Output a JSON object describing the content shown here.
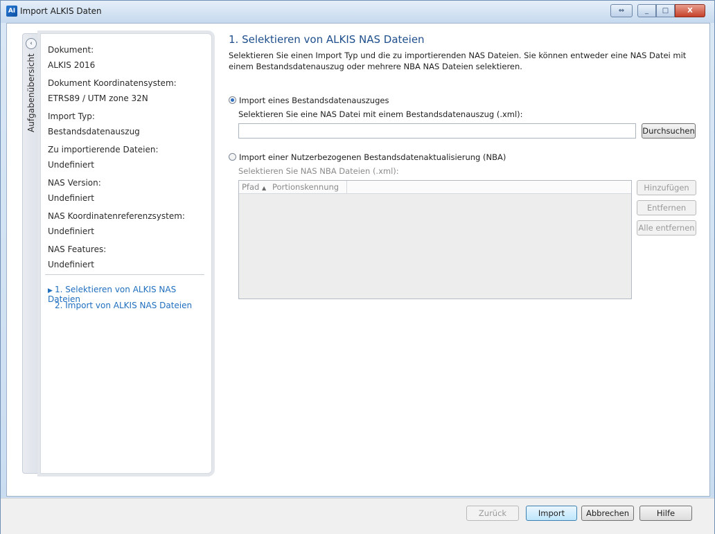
{
  "window": {
    "title": "Import ALKIS Daten",
    "icon_name": "alkis-app-icon",
    "controls": {
      "restore": "⇔",
      "minimize": "_",
      "maximize": "□",
      "close": "X"
    }
  },
  "sidebar": {
    "collapse_glyph": "‹",
    "tab_label": "Aufgabenübersicht",
    "summary": [
      {
        "label": "Dokument:",
        "value": "ALKIS 2016"
      },
      {
        "label": "Dokument Koordinatensystem:",
        "value": "ETRS89 / UTM zone 32N"
      },
      {
        "label": "Import Typ:",
        "value": "Bestandsdatenauszug"
      },
      {
        "label": "Zu importierende Dateien:",
        "value": "Undefiniert"
      },
      {
        "label": "NAS Version:",
        "value": "Undefiniert"
      },
      {
        "label": "NAS Koordinatenreferenzsystem:",
        "value": "Undefiniert"
      },
      {
        "label": "NAS Features:",
        "value": "Undefiniert"
      }
    ],
    "steps": [
      {
        "label": "1. Selektieren von ALKIS NAS Dateien",
        "active": true
      },
      {
        "label": "2. Import von ALKIS NAS Dateien",
        "active": false
      }
    ]
  },
  "main": {
    "title": "1. Selektieren von ALKIS NAS Dateien",
    "description": "Selektieren Sie einen Import Typ und die zu importierenden NAS Dateien. Sie können entweder eine NAS Datei mit einem Bestandsdatenauszug oder mehrere NBA NAS Dateien selektieren.",
    "option1": {
      "label": "Import eines Bestandsdatenauszuges",
      "selected": true,
      "sublabel": "Selektieren Sie eine NAS Datei mit einem Bestandsdatenauszug (.xml):",
      "input_value": "",
      "browse_label": "Durchsuchen"
    },
    "option2": {
      "label": "Import einer Nutzerbezogenen Bestandsdatenaktualisierung (NBA)",
      "selected": false,
      "sublabel": "Selektieren Sie NAS NBA Dateien (.xml):",
      "columns": [
        "Pfad",
        "Portionskennung"
      ],
      "sort_glyph": "▲",
      "rows": [],
      "add_label": "Hinzufügen",
      "remove_label": "Entfernen",
      "remove_all_label": "Alle entfernen"
    }
  },
  "footer": {
    "back_label": "Zurück",
    "import_label": "Import",
    "cancel_label": "Abbrechen",
    "help_label": "Hilfe"
  }
}
